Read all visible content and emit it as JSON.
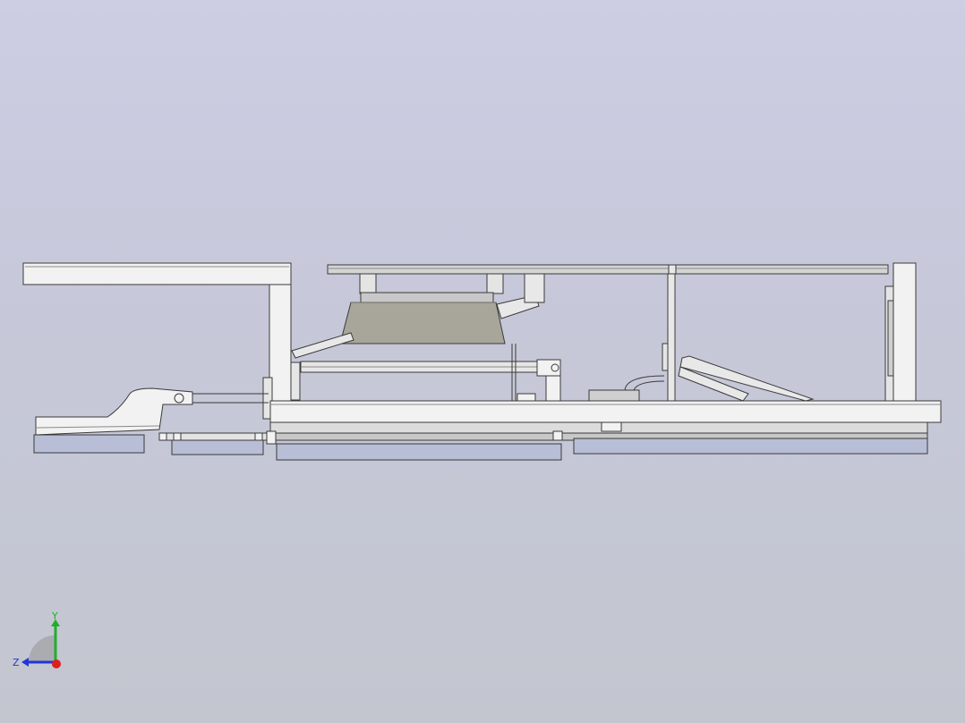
{
  "viewport": {
    "background_top": "#cdcde3",
    "background_bottom": "#c3c6cf"
  },
  "model": {
    "edge_color": "#3a3a3a",
    "face_color": "#f2f2f2",
    "shade_color": "#d9d9d9",
    "funnel_color": "#a8a69a",
    "slider_color": "#b8bed6"
  },
  "triad": {
    "y_label": "Y",
    "z_label": "Z",
    "y_color": "#1fae2c",
    "z_color": "#2236d6",
    "x_color": "#e01e1e"
  }
}
